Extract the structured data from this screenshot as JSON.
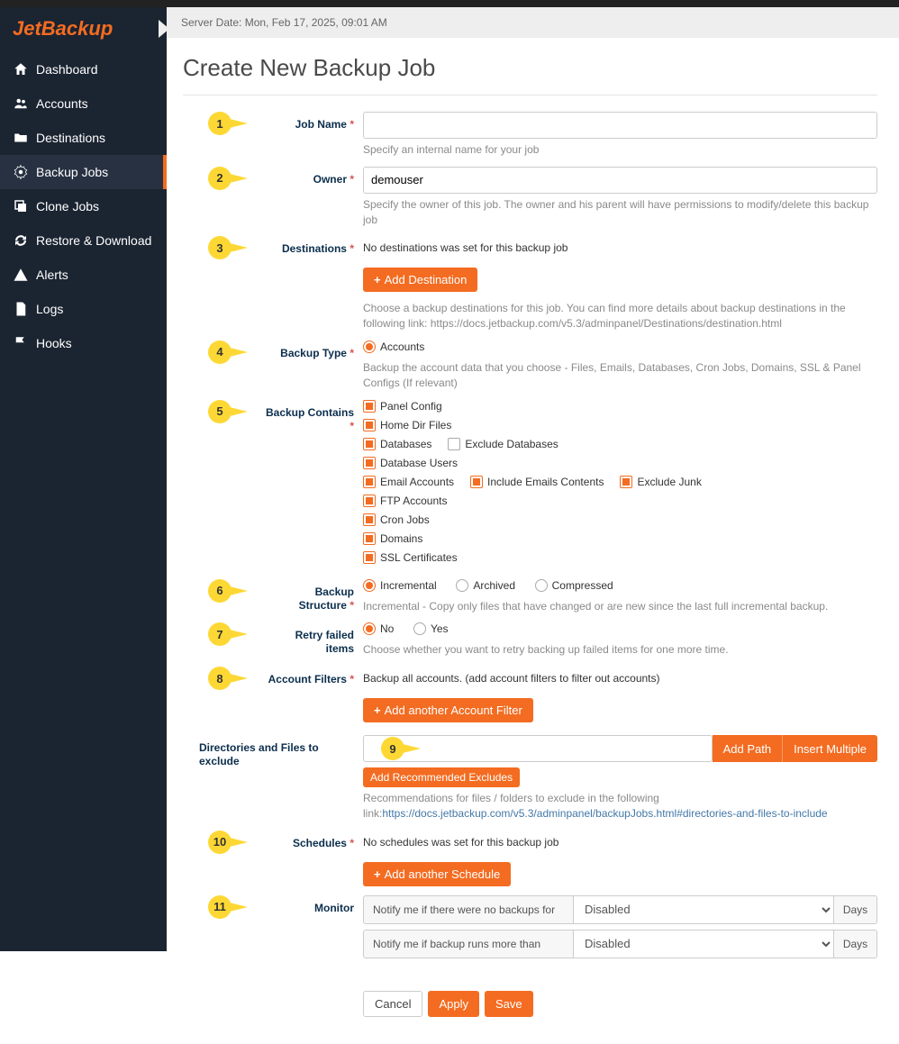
{
  "logo_alt": "JetBackup",
  "server_date": "Server Date: Mon, Feb 17, 2025, 09:01 AM",
  "page_title": "Create New Backup Job",
  "sidebar": [
    {
      "label": "Dashboard",
      "icon": "home"
    },
    {
      "label": "Accounts",
      "icon": "users"
    },
    {
      "label": "Destinations",
      "icon": "folder"
    },
    {
      "label": "Backup Jobs",
      "icon": "cog",
      "active": true
    },
    {
      "label": "Clone Jobs",
      "icon": "clone"
    },
    {
      "label": "Restore & Download",
      "icon": "sync"
    },
    {
      "label": "Alerts",
      "icon": "warning"
    },
    {
      "label": "Logs",
      "icon": "file"
    },
    {
      "label": "Hooks",
      "icon": "flag"
    }
  ],
  "fields": {
    "job_name": {
      "label": "Job Name",
      "value": "",
      "hint": "Specify an internal name for your job"
    },
    "owner": {
      "label": "Owner",
      "value": "demouser",
      "hint": "Specify the owner of this job. The owner and his parent will have permissions to modify/delete this backup job"
    },
    "destinations": {
      "label": "Destinations",
      "status": "No destinations was set for this backup job",
      "btn": "Add Destination",
      "hint": "Choose a backup destinations for this job. You can find more details about backup destinations in the following link: https://docs.jetbackup.com/v5.3/adminpanel/Destinations/destination.html"
    },
    "backup_type": {
      "label": "Backup Type",
      "option": "Accounts",
      "hint": "Backup the account data that you choose - Files, Emails, Databases, Cron Jobs, Domains, SSL & Panel Configs (If relevant)"
    },
    "contains": {
      "label": "Backup Contains",
      "items": [
        {
          "label": "Panel Config",
          "checked": true
        },
        {
          "label": "Home Dir Files",
          "checked": true
        },
        {
          "label": "Databases",
          "checked": true,
          "sub": {
            "label": "Exclude Databases",
            "checked": false
          }
        },
        {
          "label": "Database Users",
          "checked": true
        },
        {
          "label": "Email Accounts",
          "checked": true,
          "subs": [
            {
              "label": "Include Emails Contents",
              "checked": true
            },
            {
              "label": "Exclude Junk",
              "checked": true
            }
          ]
        },
        {
          "label": "FTP Accounts",
          "checked": true
        },
        {
          "label": "Cron Jobs",
          "checked": true
        },
        {
          "label": "Domains",
          "checked": true
        },
        {
          "label": "SSL Certificates",
          "checked": true
        }
      ]
    },
    "structure": {
      "label": "Backup Structure",
      "options": [
        "Incremental",
        "Archived",
        "Compressed"
      ],
      "selected": "Incremental",
      "hint": "Incremental - Copy only files that have changed or are new since the last full incremental backup."
    },
    "retry": {
      "label": "Retry failed items",
      "options": [
        "No",
        "Yes"
      ],
      "selected": "No",
      "hint": "Choose whether you want to retry backing up failed items for one more time."
    },
    "filters": {
      "label": "Account Filters",
      "status": "Backup all accounts. (add account filters to filter out accounts)",
      "btn": "Add another Account Filter"
    },
    "exclude": {
      "label": "Directories and Files to exclude",
      "btn_addpath": "Add Path",
      "btn_insertmulti": "Insert Multiple",
      "btn_recommended": "Add Recommended Excludes",
      "hint_pre": "Recommendations for files / folders to exclude in the following link:",
      "hint_link": "https://docs.jetbackup.com/v5.3/adminpanel/backupJobs.html#directories-and-files-to-include"
    },
    "schedules": {
      "label": "Schedules",
      "status": "No schedules was set for this backup job",
      "btn": "Add another Schedule"
    },
    "monitor": {
      "label": "Monitor",
      "row1": "Notify me if there were no backups for",
      "row2": "Notify me if backup runs more than",
      "disabled": "Disabled",
      "days": "Days"
    }
  },
  "buttons": {
    "cancel": "Cancel",
    "apply": "Apply",
    "save": "Save"
  }
}
